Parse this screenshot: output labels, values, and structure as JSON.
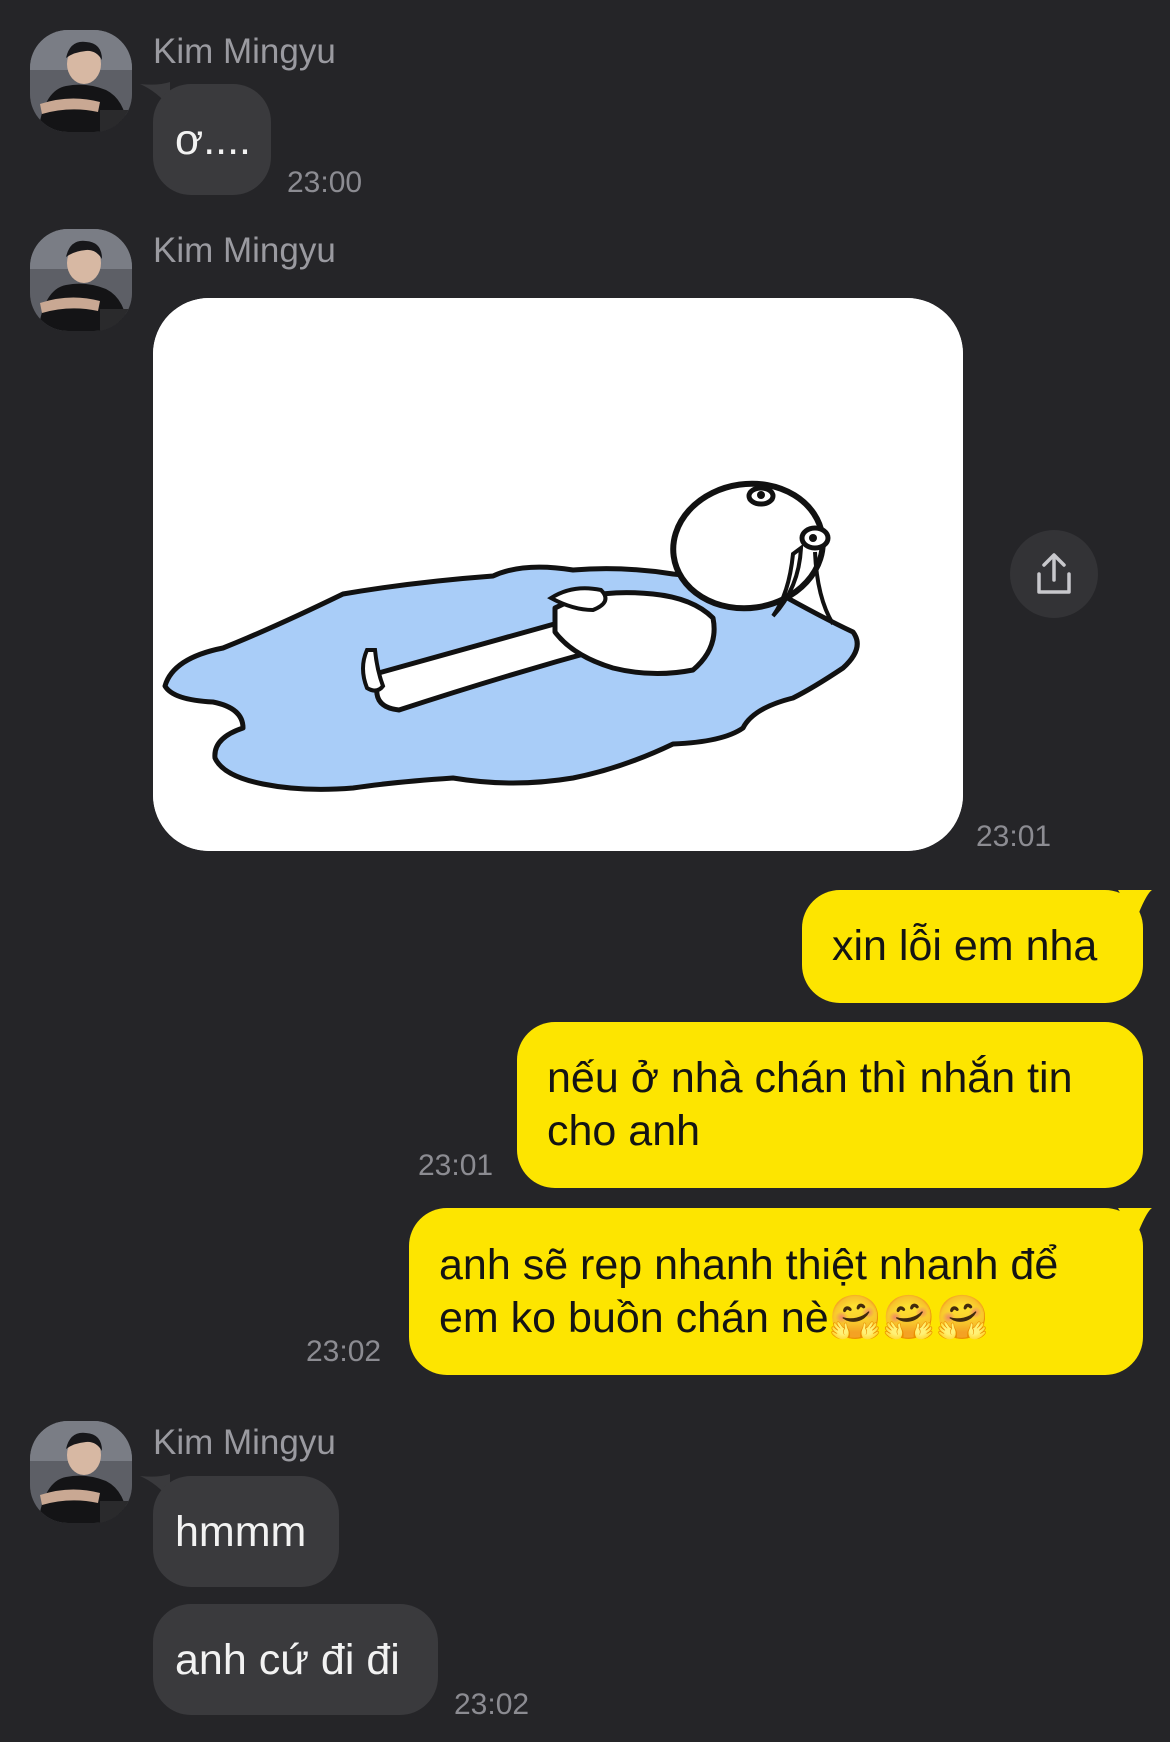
{
  "conversation": {
    "contact_name": "Kim Mingyu",
    "messages": [
      {
        "direction": "incoming",
        "sender": "Kim Mingyu",
        "text": "ơ....",
        "time": "23:00"
      },
      {
        "direction": "incoming",
        "sender": "Kim Mingyu",
        "type": "image",
        "image_desc": "sticker-crying-figure-lying-in-puddle",
        "time": "23:01"
      },
      {
        "direction": "outgoing",
        "text": "xin lỗi em nha"
      },
      {
        "direction": "outgoing",
        "text_line1": "nếu ở nhà chán thì nhắn tin",
        "text_line2": "cho anh",
        "time": "23:01"
      },
      {
        "direction": "outgoing",
        "text_line1": "anh sẽ rep nhanh thiệt nhanh để",
        "text_line2": "em ko buồn chán nè",
        "emojis": "🤗🤗🤗",
        "time": "23:02"
      },
      {
        "direction": "incoming",
        "sender": "Kim Mingyu",
        "text": "hmmm"
      },
      {
        "direction": "incoming",
        "text": "anh cứ đi đi",
        "time": "23:02"
      }
    ]
  },
  "icons": {
    "share": "share-icon",
    "avatar": "avatar"
  },
  "colors": {
    "background": "#252528",
    "incoming_bubble": "#3a3a3d",
    "outgoing_bubble": "#fde500",
    "timestamp": "#8c8c92",
    "sender_name": "#9a9aa0"
  }
}
